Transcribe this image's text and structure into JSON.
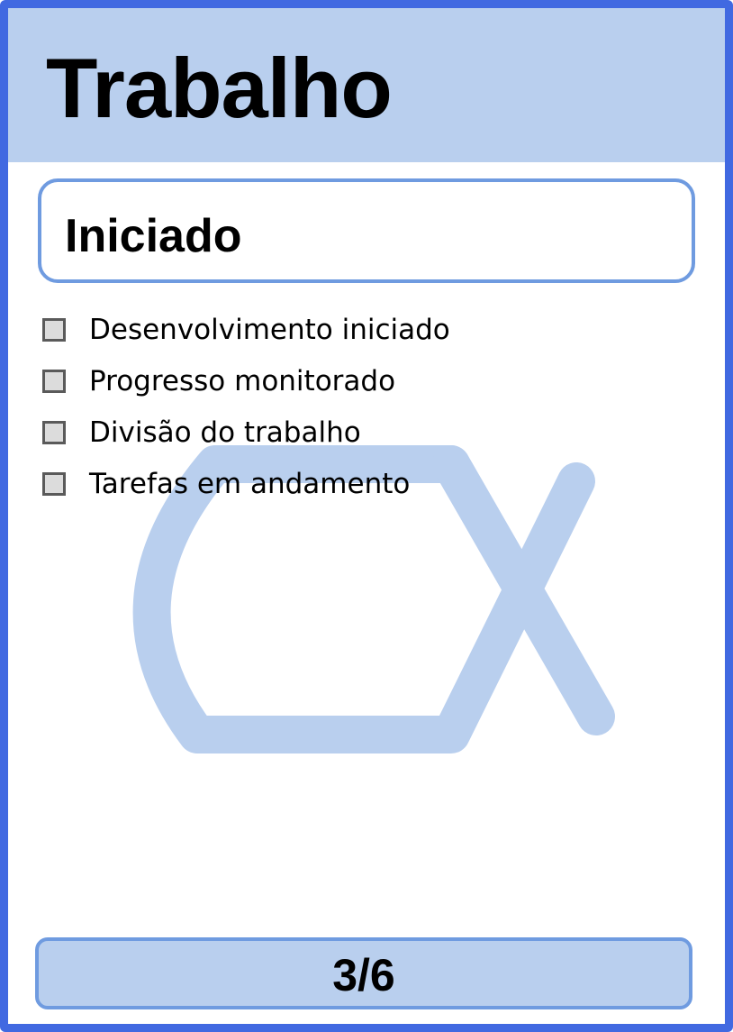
{
  "card": {
    "title": "Trabalho",
    "status": "Iniciado",
    "checklist": [
      {
        "label": "Desenvolvimento iniciado",
        "checked": false
      },
      {
        "label": "Progresso monitorado",
        "checked": false
      },
      {
        "label": "Divisão do trabalho",
        "checked": false
      },
      {
        "label": "Tarefas em andamento",
        "checked": false
      }
    ],
    "page": "3/6"
  },
  "colors": {
    "border": "#4169e1",
    "header_fill": "#b9cfee",
    "box_border": "#6f9be0",
    "watermark": "#b9cfee"
  },
  "icons": {
    "watermark": "cx-logo-icon"
  }
}
